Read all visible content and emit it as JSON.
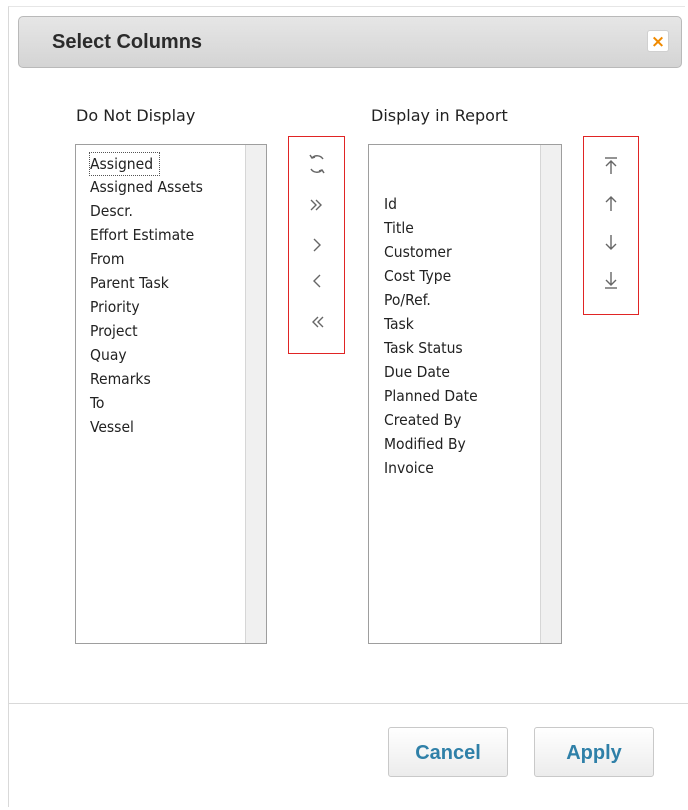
{
  "dialog": {
    "title": "Select Columns",
    "close_glyph": "×"
  },
  "left_panel": {
    "label": "Do Not Display",
    "items": [
      "Assigned",
      "Assigned Assets",
      "Descr.",
      "Effort Estimate",
      "From",
      "Parent Task",
      "Priority",
      "Project",
      "Quay",
      "Remarks",
      "To",
      "Vessel"
    ]
  },
  "right_panel": {
    "label": "Display in Report",
    "items": [
      "Id",
      "Title",
      "Customer",
      "Cost Type",
      "Po/Ref.",
      "Task",
      "Task Status",
      "Due Date",
      "Planned Date",
      "Created By",
      "Modified By",
      "Invoice"
    ]
  },
  "transfer_buttons": [
    {
      "name": "reset-icon",
      "glyph": "⟲"
    },
    {
      "name": "move-all-right-icon",
      "glyph": "»"
    },
    {
      "name": "move-right-icon",
      "glyph": "›"
    },
    {
      "name": "move-left-icon",
      "glyph": "‹"
    },
    {
      "name": "move-all-left-icon",
      "glyph": "«"
    }
  ],
  "order_buttons": [
    {
      "name": "move-top-icon"
    },
    {
      "name": "move-up-icon"
    },
    {
      "name": "move-down-icon"
    },
    {
      "name": "move-bottom-icon"
    }
  ],
  "footer": {
    "cancel_label": "Cancel",
    "apply_label": "Apply"
  },
  "colors": {
    "accent_red": "#e02424",
    "button_text": "#2f80a8",
    "close_icon": "#f08a00"
  }
}
